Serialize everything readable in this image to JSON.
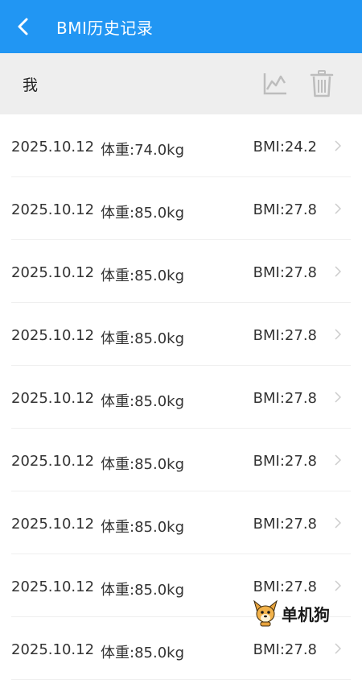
{
  "appbar": {
    "title": "BMI历史记录"
  },
  "toolbar": {
    "user": "我",
    "chart_icon": "line-chart-icon",
    "trash_icon": "trash-icon"
  },
  "records": [
    {
      "date": "2025.10.12",
      "weight": "体重:74.0kg",
      "bmi": "BMI:24.2"
    },
    {
      "date": "2025.10.12",
      "weight": "体重:85.0kg",
      "bmi": "BMI:27.8"
    },
    {
      "date": "2025.10.12",
      "weight": "体重:85.0kg",
      "bmi": "BMI:27.8"
    },
    {
      "date": "2025.10.12",
      "weight": "体重:85.0kg",
      "bmi": "BMI:27.8"
    },
    {
      "date": "2025.10.12",
      "weight": "体重:85.0kg",
      "bmi": "BMI:27.8"
    },
    {
      "date": "2025.10.12",
      "weight": "体重:85.0kg",
      "bmi": "BMI:27.8"
    },
    {
      "date": "2025.10.12",
      "weight": "体重:85.0kg",
      "bmi": "BMI:27.8"
    },
    {
      "date": "2025.10.12",
      "weight": "体重:85.0kg",
      "bmi": "BMI:27.8"
    },
    {
      "date": "2025.10.12",
      "weight": "体重:85.0kg",
      "bmi": "BMI:27.8"
    }
  ],
  "watermark": {
    "text": "单机狗"
  },
  "colors": {
    "primary": "#2196F3",
    "toolbar_bg": "#EEEEEE",
    "icon_gray": "#BDBDBD"
  }
}
